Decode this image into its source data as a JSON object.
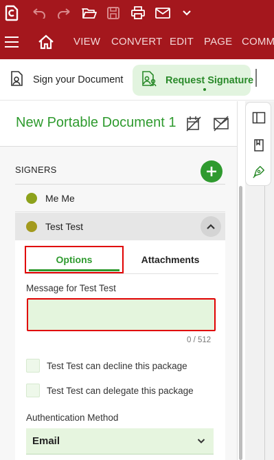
{
  "menu": {
    "items": [
      "VIEW",
      "CONVERT",
      "EDIT",
      "PAGE",
      "COMM"
    ]
  },
  "toolbar": {
    "sign_document": "Sign your Document",
    "request_signature": "Request Signature"
  },
  "document": {
    "title": "New Portable Document 1"
  },
  "signers": {
    "heading": "SIGNERS",
    "list": [
      {
        "name": "Me Me",
        "color": "#8da21c"
      },
      {
        "name": "Test Test",
        "color": "#a39a1e"
      }
    ]
  },
  "detail": {
    "tabs": {
      "options": "Options",
      "attachments": "Attachments"
    },
    "message_label": "Message for Test Test",
    "message_value": "",
    "counter": "0 / 512",
    "checkboxes": [
      {
        "label": "Test Test can decline this package",
        "checked": false
      },
      {
        "label": "Test Test can delegate this package",
        "checked": false
      }
    ],
    "auth_label": "Authentication Method",
    "auth_value": "Email"
  },
  "colors": {
    "brand_red": "#a4171d",
    "accent_green": "#2e9a2e",
    "highlight_red": "#e00000"
  }
}
